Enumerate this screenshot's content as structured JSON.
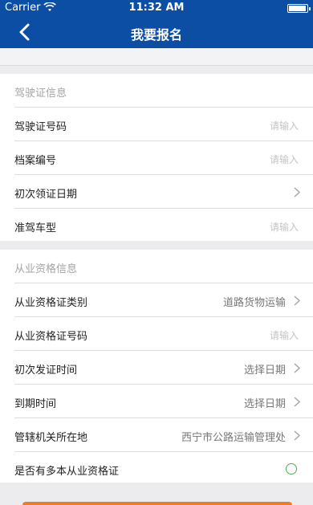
{
  "status_bar": {
    "carrier": "Carrier",
    "time": "11:32 AM"
  },
  "nav": {
    "title": "我要报名"
  },
  "sections": [
    {
      "header": "驾驶证信息",
      "rows": [
        {
          "label": "驾驶证号码",
          "placeholder": "请输入"
        },
        {
          "label": "档案编号",
          "placeholder": "请输入"
        },
        {
          "label": "初次领证日期",
          "value": ""
        },
        {
          "label": "准驾车型",
          "placeholder": "请输入"
        }
      ]
    },
    {
      "header": "从业资格信息",
      "rows": [
        {
          "label": "从业资格证类别",
          "value": "道路货物运输"
        },
        {
          "label": "从业资格证号码",
          "placeholder": "请输入"
        },
        {
          "label": "初次发证时间",
          "value": "选择日期"
        },
        {
          "label": "到期时间",
          "value": "选择日期"
        },
        {
          "label": "管辖机关所在地",
          "value": "西宁市公路运输管理处"
        },
        {
          "label": "是否有多本从业资格证",
          "checked": false
        }
      ]
    }
  ],
  "colors": {
    "nav": "#0b4ea3",
    "toggle": "#4caf50",
    "submit": "#f37b1d"
  },
  "icons": {
    "back": "chevron-left-icon",
    "row_arrow": "chevron-right-icon",
    "radio": "radio-icon"
  }
}
